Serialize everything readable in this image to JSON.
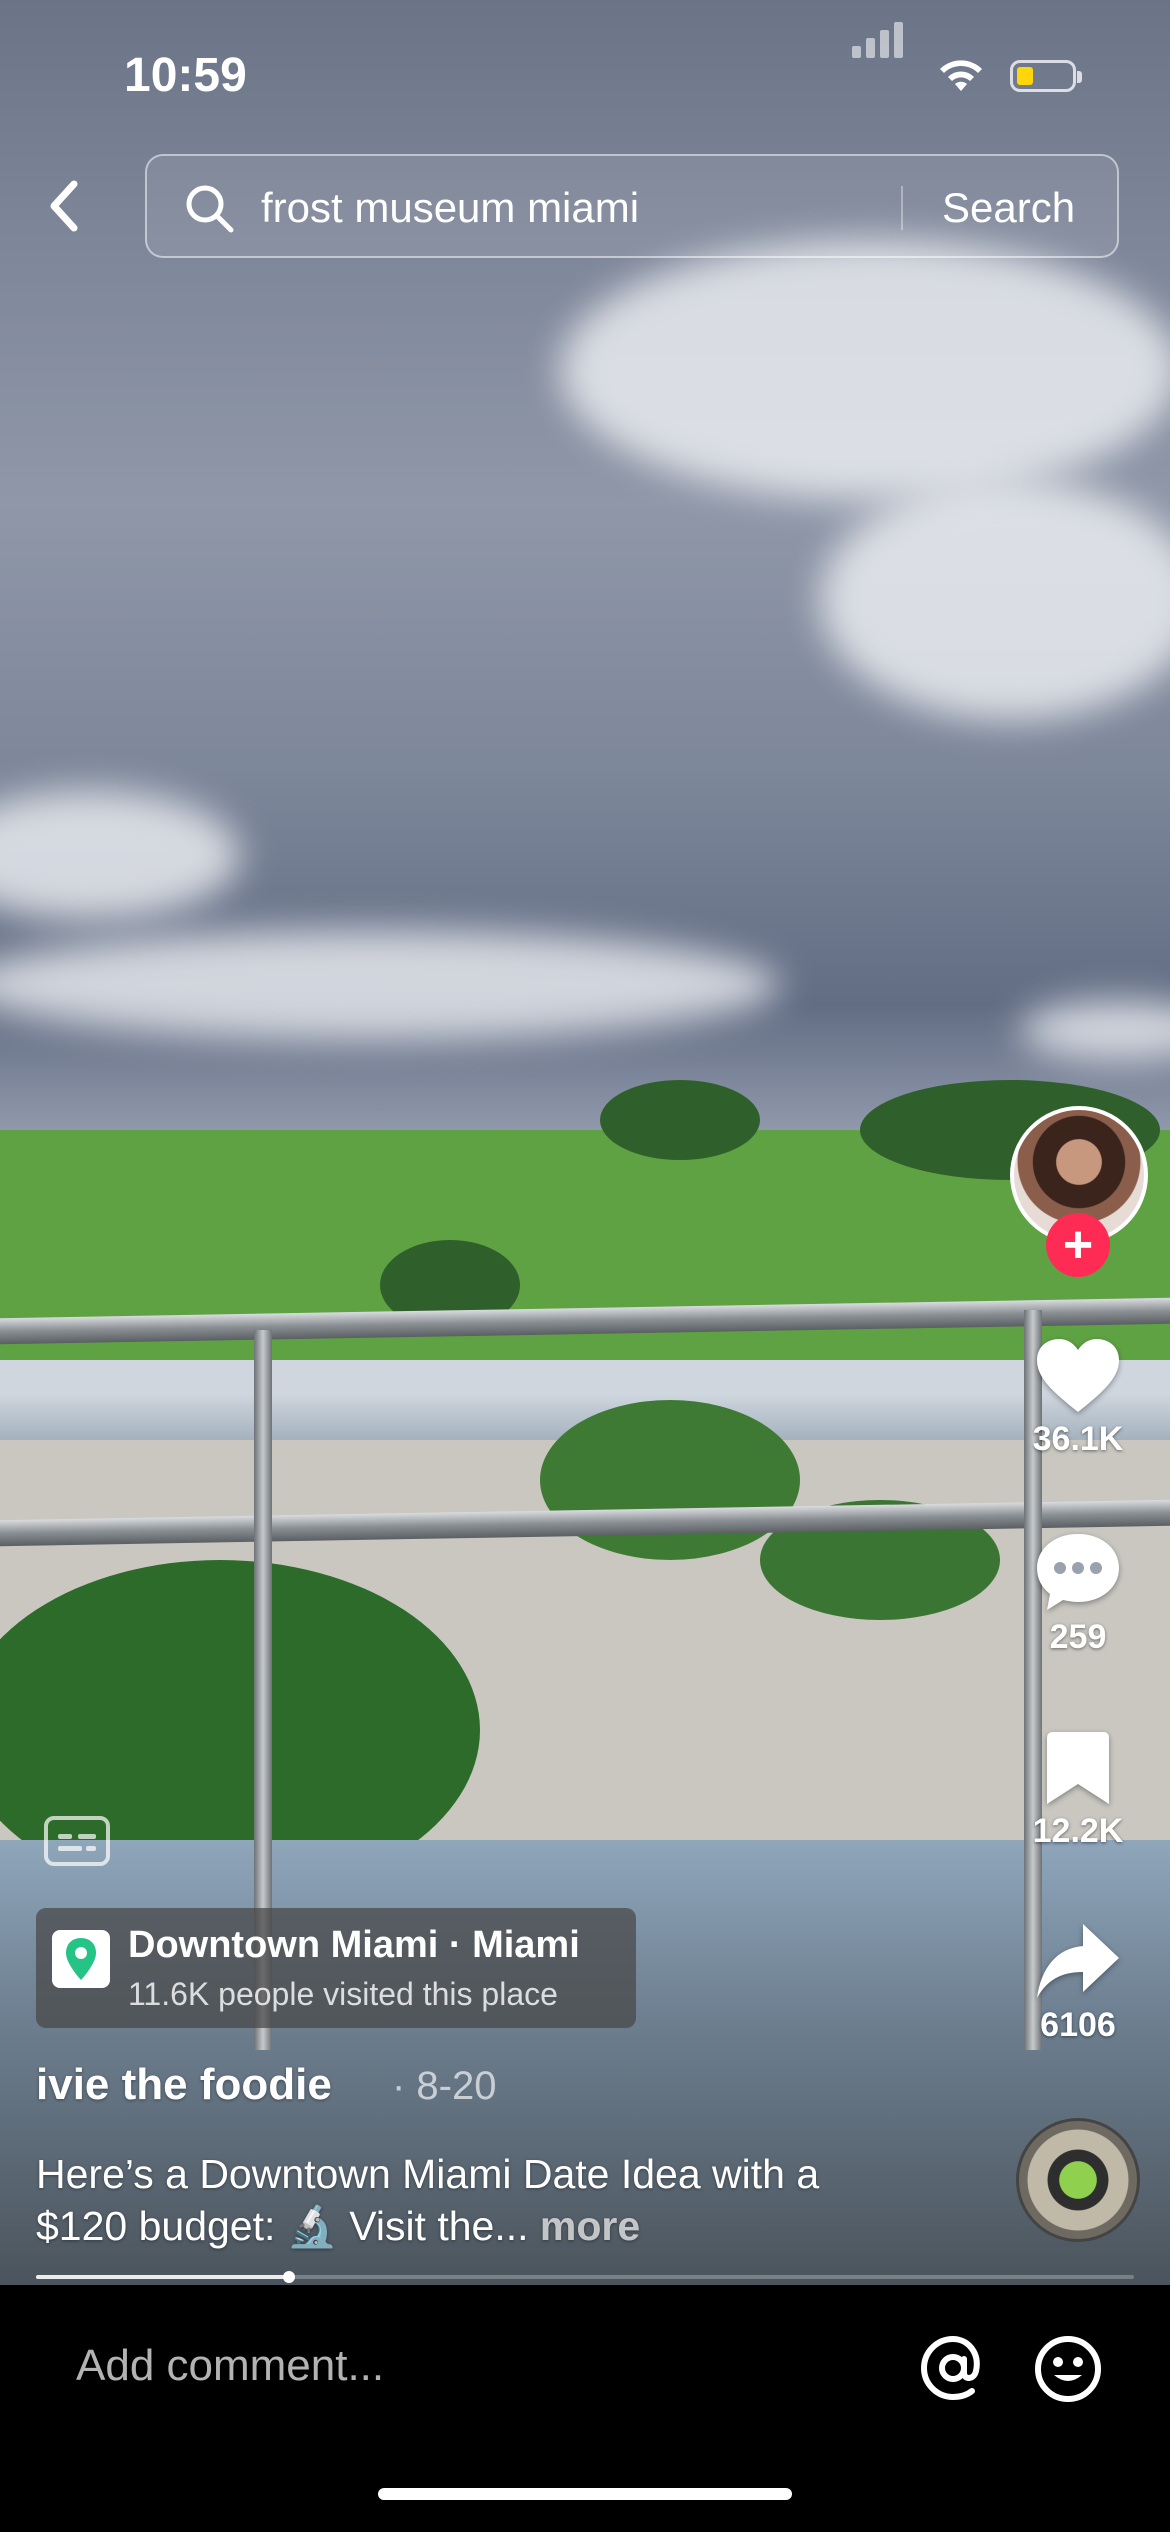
{
  "status_bar": {
    "time": "10:59"
  },
  "search": {
    "query": "frost museum miami",
    "button_label": "Search"
  },
  "actions": {
    "likes": "36.1K",
    "comments": "259",
    "saves": "12.2K",
    "shares": "6106"
  },
  "location": {
    "title": "Downtown Miami · Miami",
    "subtitle": "11.6K people visited this place"
  },
  "post": {
    "author": "ivie the foodie",
    "date": "· 8-20",
    "caption": "Here’s a Downtown Miami Date Idea with a $120 budget: 🔬 Visit the...",
    "more_label": "more",
    "progress": 0.23
  },
  "comment_bar": {
    "placeholder": "Add comment..."
  },
  "colors": {
    "follow": "#fe2c55",
    "battery": "#ffd60a"
  }
}
